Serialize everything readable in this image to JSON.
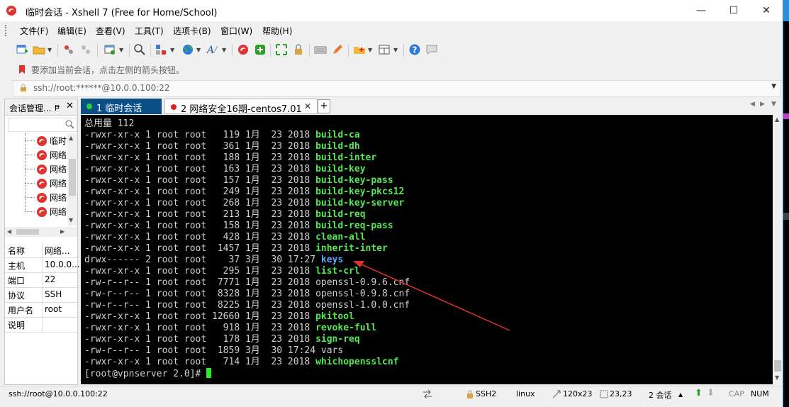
{
  "window": {
    "title": "临时会话 - Xshell 7 (Free for Home/School)",
    "controls": [
      "—",
      "☐",
      "✕"
    ]
  },
  "menu": [
    "文件(F)",
    "编辑(E)",
    "查看(V)",
    "工具(T)",
    "选项卡(B)",
    "窗口(W)",
    "帮助(H)"
  ],
  "hint": "要添加当前会话，点击左侧的箭头按钮。",
  "address": "ssh://root:******@10.0.0.100:22",
  "sidebar": {
    "title": "会话管理...",
    "pin": "ᵽ",
    "close": "✕",
    "tree": [
      {
        "label": "临时"
      },
      {
        "label": "网络"
      },
      {
        "label": "网络"
      },
      {
        "label": "网络"
      },
      {
        "label": "网络"
      },
      {
        "label": "网络"
      }
    ],
    "props": [
      {
        "k": "名称",
        "v": "网络..."
      },
      {
        "k": "主机",
        "v": "10.0.0..."
      },
      {
        "k": "端口",
        "v": "22"
      },
      {
        "k": "协议",
        "v": "SSH"
      },
      {
        "k": "用户名",
        "v": "root"
      },
      {
        "k": "说明",
        "v": ""
      }
    ]
  },
  "tabs": [
    {
      "label": "1 临时会话",
      "status_color": "#2ecc40"
    },
    {
      "label": "2 网络安全16期-centos7.01",
      "status_color": "#e02020"
    }
  ],
  "terminal": {
    "header": "总用量 112",
    "rows": [
      {
        "meta": "-rwxr-xr-x 1 root root   119 1月  23 2018 ",
        "name": "build-ca",
        "style": "exec"
      },
      {
        "meta": "-rwxr-xr-x 1 root root   361 1月  23 2018 ",
        "name": "build-dh",
        "style": "exec"
      },
      {
        "meta": "-rwxr-xr-x 1 root root   188 1月  23 2018 ",
        "name": "build-inter",
        "style": "exec"
      },
      {
        "meta": "-rwxr-xr-x 1 root root   163 1月  23 2018 ",
        "name": "build-key",
        "style": "exec"
      },
      {
        "meta": "-rwxr-xr-x 1 root root   157 1月  23 2018 ",
        "name": "build-key-pass",
        "style": "exec"
      },
      {
        "meta": "-rwxr-xr-x 1 root root   249 1月  23 2018 ",
        "name": "build-key-pkcs12",
        "style": "exec"
      },
      {
        "meta": "-rwxr-xr-x 1 root root   268 1月  23 2018 ",
        "name": "build-key-server",
        "style": "exec"
      },
      {
        "meta": "-rwxr-xr-x 1 root root   213 1月  23 2018 ",
        "name": "build-req",
        "style": "exec"
      },
      {
        "meta": "-rwxr-xr-x 1 root root   158 1月  23 2018 ",
        "name": "build-req-pass",
        "style": "exec"
      },
      {
        "meta": "-rwxr-xr-x 1 root root   428 1月  23 2018 ",
        "name": "clean-all",
        "style": "exec"
      },
      {
        "meta": "-rwxr-xr-x 1 root root  1457 1月  23 2018 ",
        "name": "inherit-inter",
        "style": "exec"
      },
      {
        "meta": "drwx------ 2 root root    37 3月  30 17:27 ",
        "name": "keys",
        "style": "dir"
      },
      {
        "meta": "-rwxr-xr-x 1 root root   295 1月  23 2018 ",
        "name": "list-crl",
        "style": "exec"
      },
      {
        "meta": "-rw-r--r-- 1 root root  7771 1月  23 2018 ",
        "name": "openssl-0.9.6.cnf",
        "style": "plain"
      },
      {
        "meta": "-rw-r--r-- 1 root root  8328 1月  23 2018 ",
        "name": "openssl-0.9.8.cnf",
        "style": "plain"
      },
      {
        "meta": "-rw-r--r-- 1 root root  8225 1月  23 2018 ",
        "name": "openssl-1.0.0.cnf",
        "style": "plain"
      },
      {
        "meta": "-rwxr-xr-x 1 root root 12660 1月  23 2018 ",
        "name": "pkitool",
        "style": "exec"
      },
      {
        "meta": "-rwxr-xr-x 1 root root   918 1月  23 2018 ",
        "name": "revoke-full",
        "style": "exec"
      },
      {
        "meta": "-rwxr-xr-x 1 root root   178 1月  23 2018 ",
        "name": "sign-req",
        "style": "exec"
      },
      {
        "meta": "-rw-r--r-- 1 root root  1859 3月  30 17:24 ",
        "name": "vars",
        "style": "plain"
      },
      {
        "meta": "-rwxr-xr-x 1 root root   714 1月  23 2018 ",
        "name": "whichopensslcnf",
        "style": "exec"
      }
    ],
    "prompt": "[root@vpnserver 2.0]# "
  },
  "status": {
    "connection": "ssh://root@10.0.0.100:22",
    "protocol": "SSH2",
    "terminal_type": "linux",
    "size": "120x23",
    "cursor": "23,23",
    "sessions": "2 会话",
    "caps": "CAP",
    "num": "NUM"
  },
  "colors": {
    "accent": "#0c4f87",
    "exec": "#55e655",
    "dir": "#5aa8ff",
    "arrow": "#e03030"
  }
}
